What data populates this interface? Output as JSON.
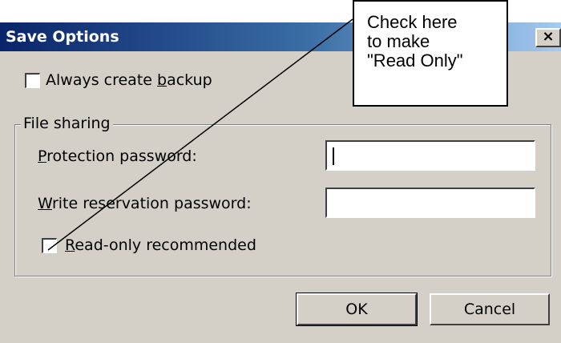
{
  "dialog": {
    "title": "Save Options",
    "close_glyph": "×"
  },
  "options": {
    "always_backup_label_pre": "Always create ",
    "always_backup_label_key": "b",
    "always_backup_label_post": "ackup",
    "always_backup_checked": false
  },
  "file_sharing": {
    "legend": "File sharing",
    "protection_label_key": "P",
    "protection_label_rest": "rotection password:",
    "protection_value": "",
    "write_label_key": "W",
    "write_label_rest": "rite reservation password:",
    "write_value": "",
    "readonly_label_key": "R",
    "readonly_label_rest": "ead-only recommended",
    "readonly_checked": false
  },
  "buttons": {
    "ok": "OK",
    "cancel": "Cancel"
  },
  "callout": {
    "lines": [
      "Check here",
      "to make",
      "\"Read Only\""
    ]
  },
  "colors": {
    "title_bar_start": "#0a246a",
    "title_bar_end": "#a6caf0",
    "dialog_face": "#d4d0c8"
  }
}
